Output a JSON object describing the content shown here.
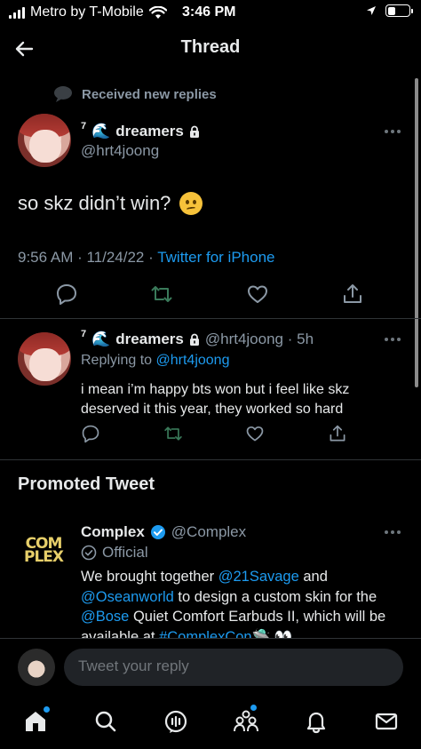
{
  "status_bar": {
    "carrier": "Metro by T-Mobile",
    "time": "3:46 PM",
    "battery_level": 0.35
  },
  "header": {
    "title": "Thread"
  },
  "thread": {
    "received_label": "Received new replies",
    "main_tweet": {
      "author_prefix": "7",
      "author_emoji": "🌊",
      "display_name": "dreamers",
      "handle": "@hrt4joong",
      "text": "so skz didn’t win?",
      "timestamp": "9:56 AM · 11/24/22 · ",
      "source": "Twitter for iPhone"
    },
    "reply_tweet": {
      "author_prefix": "7",
      "author_emoji": "🌊",
      "display_name": "dreamers",
      "handle_time": "@hrt4joong · 5h",
      "replying_prefix": "Replying to ",
      "replying_to": "@hrt4joong",
      "text": "i mean i’m happy bts won but i feel like skz deserved it this year, they worked so hard"
    }
  },
  "promoted": {
    "heading": "Promoted Tweet",
    "logo_text": "COM PLEX",
    "display_name": "Complex",
    "handle": "@Complex",
    "official_label": "Official",
    "text_parts": [
      "We brought together ",
      "@21Savage",
      " and ",
      "@Oseanworld",
      " to design a custom skin for the ",
      "@Bose",
      " Quiet Comfort Earbuds II, which will be available at ",
      "#ComplexCon",
      "🛸 👀"
    ]
  },
  "reply_bar": {
    "placeholder": "Tweet your reply"
  },
  "colors": {
    "accent": "#1d9bf0",
    "muted": "#8b98a5",
    "background": "#000000"
  },
  "icons": [
    "back-arrow-icon",
    "wifi-icon",
    "location-icon",
    "battery-icon",
    "lock-icon",
    "more-icon",
    "comment-icon",
    "retweet-icon",
    "like-icon",
    "share-icon",
    "verified-icon",
    "official-badge-icon",
    "home-icon",
    "search-icon",
    "spaces-icon",
    "communities-icon",
    "notifications-icon",
    "messages-icon"
  ]
}
